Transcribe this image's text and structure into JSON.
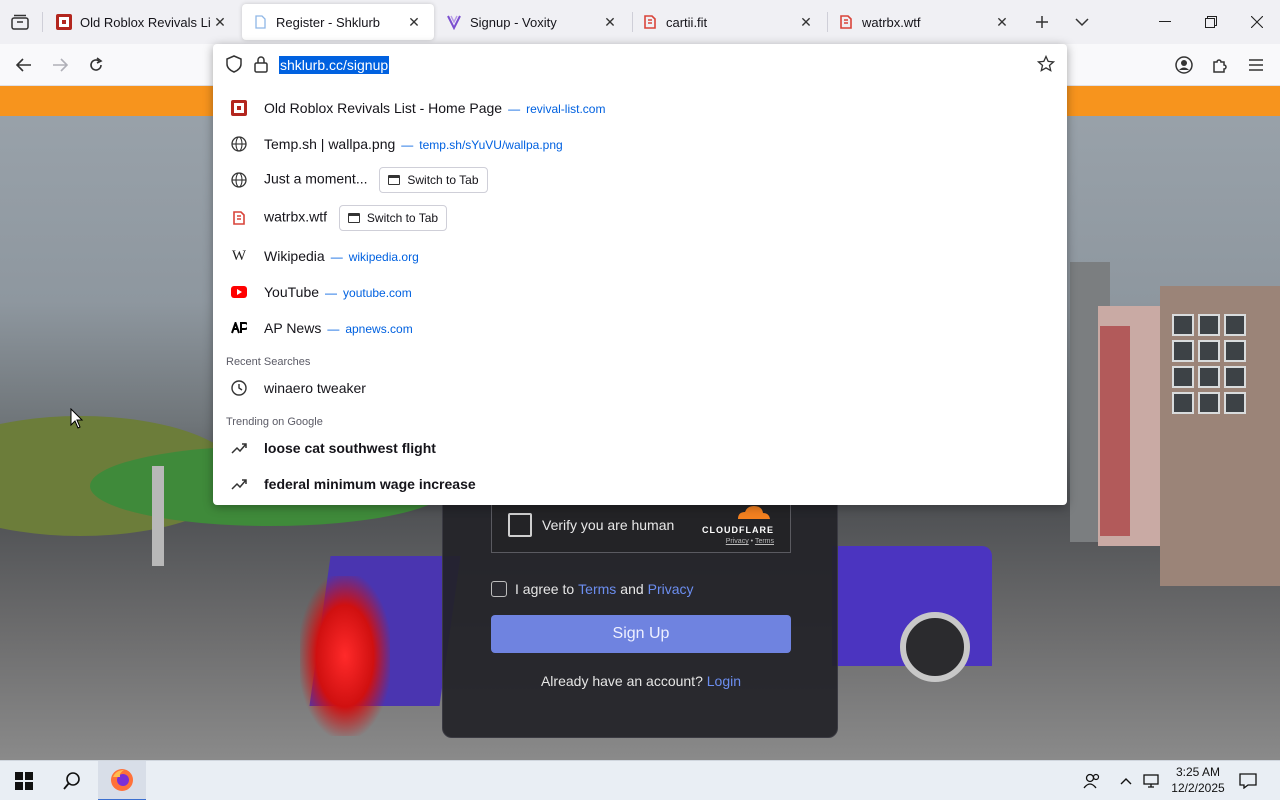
{
  "tabs": [
    {
      "title": "Old Roblox Revivals List -",
      "active": false
    },
    {
      "title": "Register - Shklurb",
      "active": true
    },
    {
      "title": "Signup - Voxity",
      "active": false
    },
    {
      "title": "cartii.fit",
      "active": false
    },
    {
      "title": "watrbx.wtf",
      "active": false
    }
  ],
  "urlbar": {
    "url": "shklurb.cc/signup"
  },
  "suggestions": [
    {
      "icon": "roblox-revivals-favicon",
      "title": "Old Roblox Revivals List - Home Page",
      "url": "revival-list.com"
    },
    {
      "icon": "globe-icon",
      "title": "Temp.sh | wallpa.png",
      "url": "temp.sh/sYuVU/wallpa.png"
    },
    {
      "icon": "globe-icon",
      "title": "Just a moment...",
      "switch": "Switch to Tab"
    },
    {
      "icon": "watrbx-favicon",
      "title": "watrbx.wtf",
      "switch": "Switch to Tab"
    },
    {
      "icon": "wikipedia-icon",
      "title": "Wikipedia",
      "url": "wikipedia.org"
    },
    {
      "icon": "youtube-icon",
      "title": "YouTube",
      "url": "youtube.com"
    },
    {
      "icon": "apnews-icon",
      "title": "AP News",
      "url": "apnews.com"
    }
  ],
  "recent": {
    "label": "Recent Searches",
    "items": [
      "winaero tweaker"
    ]
  },
  "trending": {
    "label": "Trending on Google",
    "items": [
      "loose cat southwest flight",
      "federal minimum wage increase"
    ]
  },
  "signup": {
    "captcha_text": "Verify you are human",
    "cloudflare": "CLOUDFLARE",
    "cf_privacy": "Privacy",
    "cf_sep": "•",
    "cf_terms": "Terms",
    "agree_prefix": "I agree to",
    "terms": "Terms",
    "and": "and",
    "privacy": "Privacy",
    "button": "Sign Up",
    "already": "Already have an account?",
    "login": "Login"
  },
  "taskbar": {
    "time": "3:25 AM",
    "date": "12/2/2025"
  },
  "colors": {
    "accent": "#0061e0",
    "orange_bar": "#f7941d",
    "signup_button": "#6f83e0",
    "link": "#6c8ef0"
  }
}
